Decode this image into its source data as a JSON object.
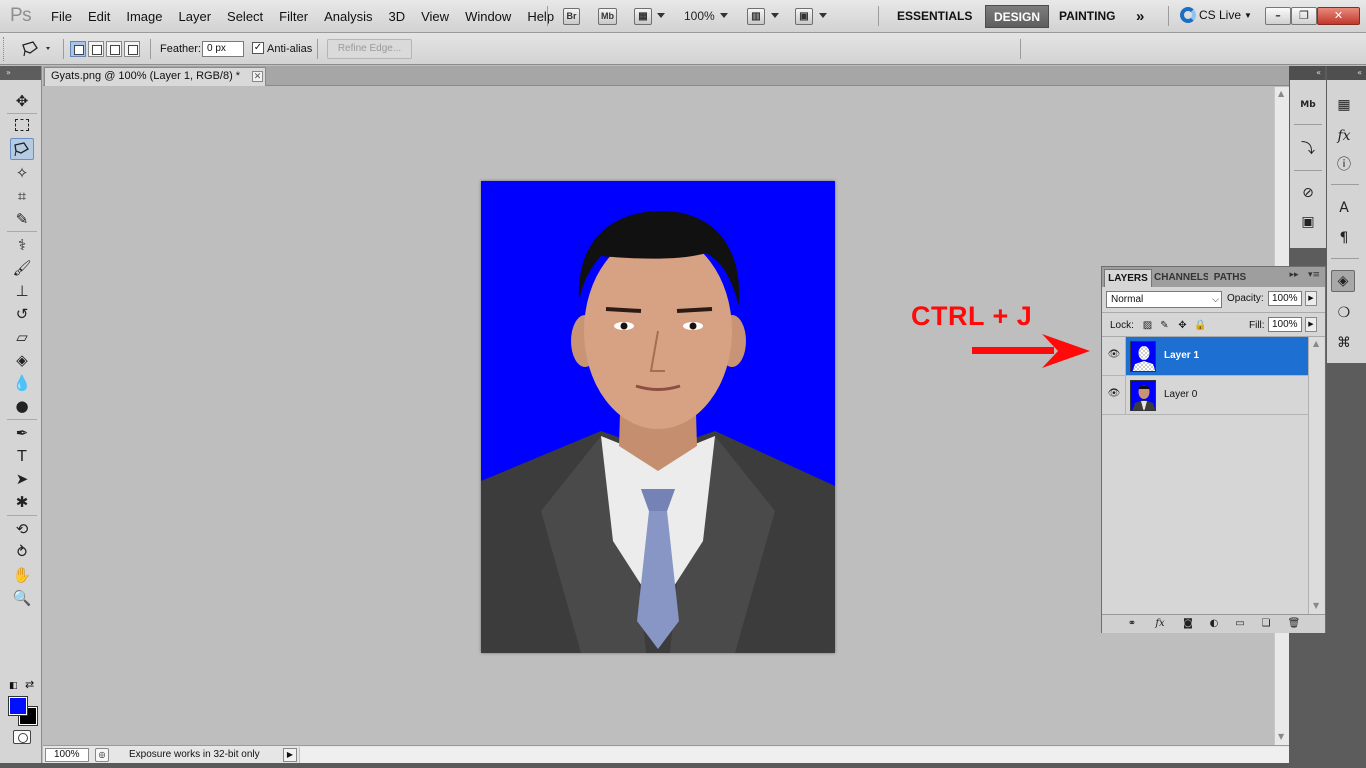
{
  "app": {
    "logo": "Ps",
    "menus": [
      "File",
      "Edit",
      "Image",
      "Layer",
      "Select",
      "Filter",
      "Analysis",
      "3D",
      "View",
      "Window",
      "Help"
    ],
    "bridge_label": "Br",
    "minibridge_label": "Mb",
    "zoom_level": "100%",
    "workspaces": [
      "ESSENTIALS",
      "DESIGN",
      "PAINTING"
    ],
    "active_workspace": "DESIGN",
    "more_workspaces": "»",
    "cs_live": "CS Live",
    "window_controls": {
      "minimize": "–",
      "restore": "❐",
      "close": "✕"
    }
  },
  "options_bar": {
    "feather_label": "Feather:",
    "feather_value": "0 px",
    "antialias_label": "Anti-alias",
    "antialias_checked": true,
    "refine_edge_label": "Refine Edge..."
  },
  "toolbar": {
    "header": "»",
    "active_tool": "polygonal-lasso",
    "foreground_color": "#0010ff",
    "background_color": "#000000"
  },
  "document": {
    "tab_title": "Gyats.png @ 100% (Layer 1, RGB/8) *",
    "close_label": "✕",
    "background_color": "#0000ff"
  },
  "status_bar": {
    "zoom": "100%",
    "info_text": "Exposure works in 32-bit only",
    "arrow": "▶"
  },
  "dock": {
    "collapse_label": "«"
  },
  "layers_panel": {
    "tabs": [
      "LAYERS",
      "CHANNELS",
      "PATHS"
    ],
    "active_tab": "LAYERS",
    "menu_label": "▸▸ ≡",
    "blend_mode": "Normal",
    "opacity_label": "Opacity:",
    "opacity_value": "100%",
    "lock_label": "Lock:",
    "fill_label": "Fill:",
    "fill_value": "100%",
    "layers": [
      {
        "name": "Layer 1",
        "selected": true,
        "visible": true
      },
      {
        "name": "Layer 0",
        "selected": false,
        "visible": true
      }
    ]
  },
  "annotation": {
    "text": "CTRL + J",
    "color": "#ff0a0a"
  }
}
